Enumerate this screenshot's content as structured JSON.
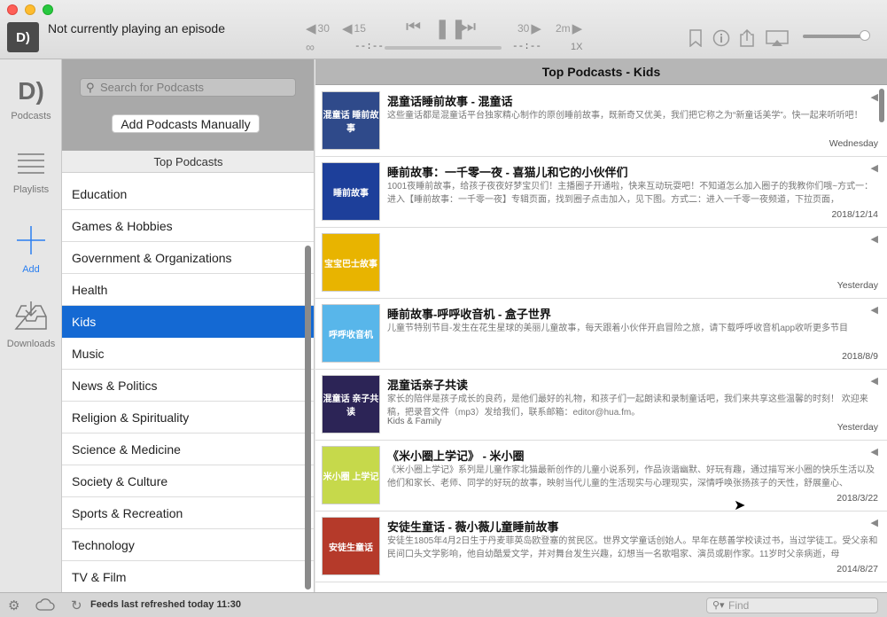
{
  "window": {
    "now_playing": "Not currently playing an episode",
    "app_logo": "D)"
  },
  "toolbar": {
    "skip_back_30": "30",
    "skip_back_15": "15",
    "skip_fwd_30": "30",
    "skip_fwd_2m": "2m",
    "time_elapsed": "--:--",
    "time_remaining": "--:--",
    "speed": "1X"
  },
  "rail": {
    "podcasts_label": "Podcasts",
    "playlists_label": "Playlists",
    "add_label": "Add",
    "downloads_label": "Downloads"
  },
  "categories": {
    "search_placeholder": "Search for Podcasts",
    "add_manual_label": "Add Podcasts Manually",
    "header": "Top Podcasts",
    "items": [
      "Education",
      "Games & Hobbies",
      "Government & Organizations",
      "Health",
      "Kids",
      "Music",
      "News & Politics",
      "Religion & Spirituality",
      "Science & Medicine",
      "Society & Culture",
      "Sports & Recreation",
      "Technology",
      "TV & Film"
    ],
    "selected": "Kids"
  },
  "podcasts": {
    "header": "Top Podcasts - Kids",
    "items": [
      {
        "title": "混童话睡前故事 - 混童话",
        "desc": "这些童话都是混童话平台独家精心制作的原创睡前故事，既新奇又优美，我们把它称之为“新童话美学”。快一起来听听吧！",
        "genre": "",
        "date": "Wednesday",
        "thumb_text": "混童话 睡前故事",
        "thumb_color": "#2f4a8a"
      },
      {
        "title": "睡前故事：一千零一夜 - 喜猫儿和它的小伙伴们",
        "desc": "1001夜睡前故事，给孩子夜夜好梦宝贝们！主播圈子开通啦，快来互动玩耍吧！不知道怎么加入圈子的我教你们哦~方式一：进入【睡前故事：一千零一夜】专辑页面，找到圈子点击加入，见下图。方式二：进入一千零一夜频道，下拉页面，",
        "genre": "",
        "date": "2018/12/14",
        "thumb_text": "睡前故事",
        "thumb_color": "#1d3f9a"
      },
      {
        "title": "",
        "desc": "",
        "genre": "",
        "date": "Yesterday",
        "thumb_text": "宝宝巴士故事",
        "thumb_color": "#e8b400"
      },
      {
        "title": "睡前故事-呼呼收音机 - 盒子世界",
        "desc": "儿童节特别节目-发生在花生星球的美丽儿童故事，每天跟着小伙伴开启冒险之旅，请下载呼呼收音机app收听更多节目",
        "genre": "",
        "date": "2018/8/9",
        "thumb_text": "呼呼收音机",
        "thumb_color": "#58b6ea"
      },
      {
        "title": "混童话亲子共读",
        "desc": "家长的陪伴是孩子成长的良药，是他们最好的礼物，和孩子们一起朗读和录制童话吧，我们来共享这些温馨的时刻！ 欢迎来稿，把录音文件（mp3）发给我们，联系邮箱：editor@hua.fm。",
        "genre": "Kids & Family",
        "date": "Yesterday",
        "thumb_text": "混童话 亲子共读",
        "thumb_color": "#2c2456"
      },
      {
        "title": "《米小圈上学记》 - 米小圈",
        "desc": "《米小圈上学记》系列是儿童作家北猫最新创作的儿童小说系列，作品诙谐幽默、好玩有趣，通过描写米小圈的快乐生活以及他们和家长、老师、同学的好玩的故事，映射当代儿童的生活现实与心理现实，深情呼唤张扬孩子的天性，舒展童心、",
        "genre": "",
        "date": "2018/3/22",
        "thumb_text": "米小圈 上学记",
        "thumb_color": "#c6d94b"
      },
      {
        "title": "安徒生童话 - 薇小薇儿童睡前故事",
        "desc": "安徒生1805年4月2日生于丹麦菲英岛欧登塞的贫民区。世界文学童话创始人。早年在慈善学校读过书，当过学徒工。受父亲和民间口头文学影响，他自幼酷爱文学，并对舞台发生兴趣，幻想当一名歌唱家、演员或剧作家。11岁时父亲病逝，母",
        "genre": "",
        "date": "2014/8/27",
        "thumb_text": "安徒生童话",
        "thumb_color": "#b53a2a"
      }
    ]
  },
  "status": {
    "refresh_text": "Feeds last refreshed today 11:30",
    "find_placeholder": "Find"
  }
}
